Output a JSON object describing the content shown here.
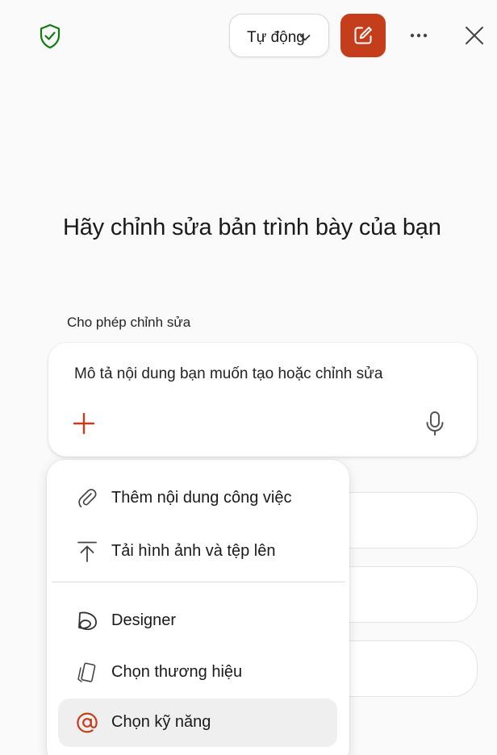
{
  "header": {
    "shield_icon": "shield-check-icon",
    "mode_label": "Tự động",
    "edit_icon": "new-edit-icon",
    "more_icon": "ellipsis-icon",
    "close_icon": "close-icon",
    "accent_color": "#c43e1c",
    "shield_color": "#107c10"
  },
  "main": {
    "heading": "Hãy chỉnh sửa bản trình bày của bạn",
    "allow_label": "Cho phép chỉnh sửa",
    "prompt": {
      "placeholder": "Mô tả nội dung bạn muốn tạo hoặc chỉnh sửa",
      "add_icon": "plus-icon",
      "mic_icon": "microphone-icon"
    }
  },
  "menu": {
    "items": [
      {
        "label": "Thêm nội dung công việc",
        "icon": "paperclip-icon"
      },
      {
        "label": "Tải hình ảnh và tệp lên",
        "icon": "upload-icon"
      },
      {
        "label": "Designer",
        "icon": "designer-icon"
      },
      {
        "label": "Chọn thương hiệu",
        "icon": "brand-kit-icon"
      },
      {
        "label": "Chọn kỹ năng",
        "icon": "at-sign-icon",
        "selected": true
      }
    ]
  }
}
